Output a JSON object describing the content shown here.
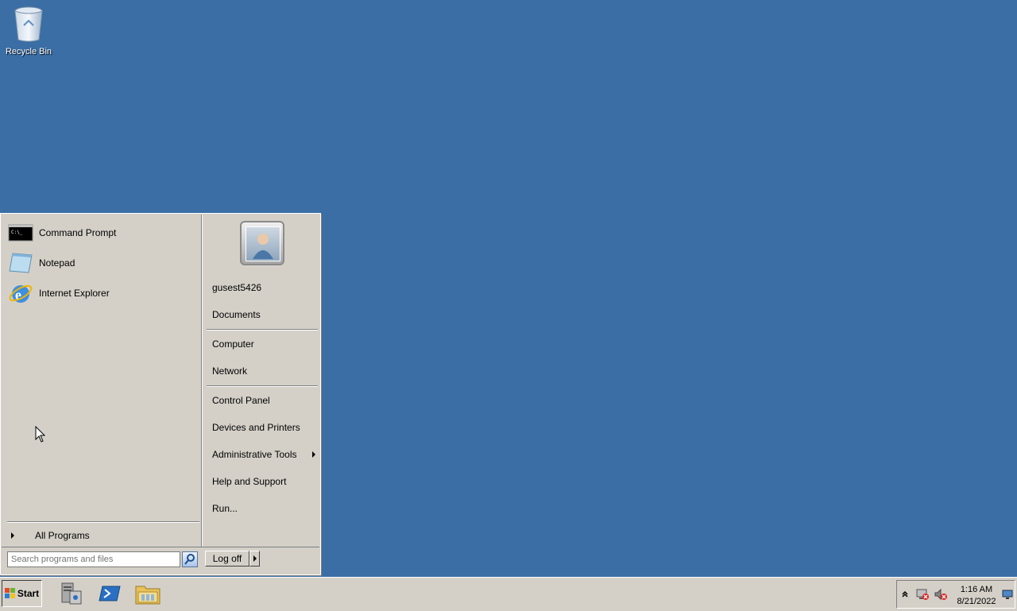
{
  "desktop": {
    "icons": [
      {
        "label": "Recycle Bin",
        "icon": "recycle-bin-icon"
      }
    ],
    "background_color": "#3a6ea5"
  },
  "start_menu": {
    "pinned_programs": [
      {
        "label": "Command Prompt",
        "icon": "command-prompt-icon"
      },
      {
        "label": "Notepad",
        "icon": "notepad-icon"
      },
      {
        "label": "Internet Explorer",
        "icon": "internet-explorer-icon"
      }
    ],
    "all_programs_label": "All Programs",
    "search_placeholder": "Search programs and files",
    "user_name": "gusest5426",
    "right_items": {
      "documents": "Documents",
      "computer": "Computer",
      "network": "Network",
      "control_panel": "Control Panel",
      "devices_printers": "Devices and Printers",
      "admin_tools": "Administrative Tools",
      "help_support": "Help and Support",
      "run": "Run..."
    },
    "log_off_label": "Log off"
  },
  "taskbar": {
    "start_label": "Start",
    "pinned": [
      "server-manager-icon",
      "powershell-icon",
      "windows-explorer-icon"
    ],
    "clock": {
      "time": "1:16 AM",
      "date": "8/21/2022"
    },
    "tray_icons": [
      "show-hidden-icons-chevron",
      "network-disconnected-icon",
      "volume-muted-icon",
      "show-desktop-icon"
    ]
  }
}
